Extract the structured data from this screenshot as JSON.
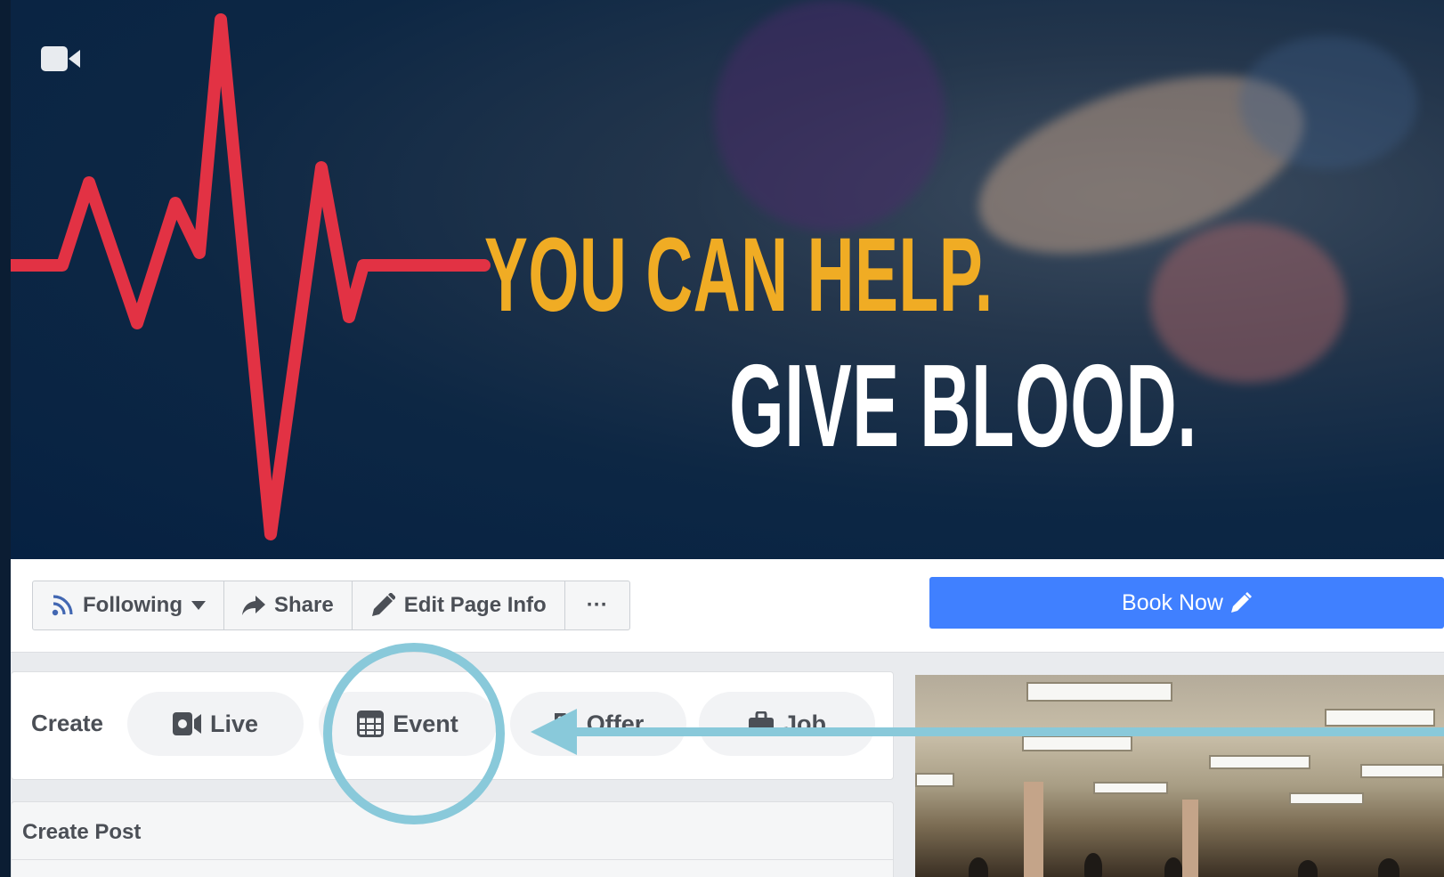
{
  "cover": {
    "headline_line1": "YOU CAN HELP.",
    "headline_line2": "GIVE BLOOD.",
    "icon": "video-camera-icon",
    "colors": {
      "background": "#062142",
      "pulse": "#e23244",
      "headline_line1": "#f0ac24",
      "headline_line2": "#ffffff"
    }
  },
  "actions": {
    "following_label": "Following",
    "share_label": "Share",
    "edit_label": "Edit Page Info",
    "more_label": "···",
    "book_now_label": "Book Now",
    "book_now_color": "#4080ff"
  },
  "create": {
    "label": "Create",
    "items": [
      {
        "label": "Live",
        "icon": "live-video-icon"
      },
      {
        "label": "Event",
        "icon": "calendar-icon"
      },
      {
        "label": "Offer",
        "icon": "tag-icon"
      },
      {
        "label": "Job",
        "icon": "briefcase-icon"
      }
    ]
  },
  "create_post": {
    "title": "Create Post"
  },
  "annotation": {
    "color": "#89c9da",
    "target": "Event"
  }
}
